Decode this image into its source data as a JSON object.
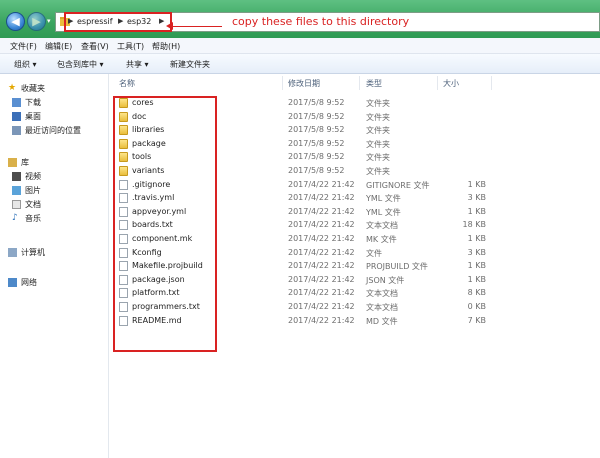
{
  "address": {
    "crumbs": [
      "espressif",
      "esp32"
    ],
    "annotation": "copy these files to this directory"
  },
  "menubar": [
    "文件(F)",
    "编辑(E)",
    "查看(V)",
    "工具(T)",
    "帮助(H)"
  ],
  "toolbar": [
    "组织 ▾",
    "包含到库中 ▾",
    "共享 ▾",
    "新建文件夹"
  ],
  "nav": {
    "favorites": "收藏夹",
    "downloads": "下载",
    "desktop": "桌面",
    "recent": "最近访问的位置",
    "libraries": "库",
    "videos": "视频",
    "pictures": "图片",
    "documents": "文档",
    "music": "音乐",
    "computer": "计算机",
    "network": "网络"
  },
  "columns": {
    "name": "名称",
    "date": "修改日期",
    "type": "类型",
    "size": "大小"
  },
  "files": [
    {
      "name": "cores",
      "date": "2017/5/8 9:52",
      "type": "文件夹",
      "size": "",
      "kind": "folder"
    },
    {
      "name": "doc",
      "date": "2017/5/8 9:52",
      "type": "文件夹",
      "size": "",
      "kind": "folder"
    },
    {
      "name": "libraries",
      "date": "2017/5/8 9:52",
      "type": "文件夹",
      "size": "",
      "kind": "folder"
    },
    {
      "name": "package",
      "date": "2017/5/8 9:52",
      "type": "文件夹",
      "size": "",
      "kind": "folder"
    },
    {
      "name": "tools",
      "date": "2017/5/8 9:52",
      "type": "文件夹",
      "size": "",
      "kind": "folder"
    },
    {
      "name": "variants",
      "date": "2017/5/8 9:52",
      "type": "文件夹",
      "size": "",
      "kind": "folder"
    },
    {
      "name": ".gitignore",
      "date": "2017/4/22 21:42",
      "type": "GITIGNORE 文件",
      "size": "1 KB",
      "kind": "file"
    },
    {
      "name": ".travis.yml",
      "date": "2017/4/22 21:42",
      "type": "YML 文件",
      "size": "3 KB",
      "kind": "file"
    },
    {
      "name": "appveyor.yml",
      "date": "2017/4/22 21:42",
      "type": "YML 文件",
      "size": "1 KB",
      "kind": "file"
    },
    {
      "name": "boards.txt",
      "date": "2017/4/22 21:42",
      "type": "文本文档",
      "size": "18 KB",
      "kind": "file"
    },
    {
      "name": "component.mk",
      "date": "2017/4/22 21:42",
      "type": "MK 文件",
      "size": "1 KB",
      "kind": "file"
    },
    {
      "name": "Kconfig",
      "date": "2017/4/22 21:42",
      "type": "文件",
      "size": "3 KB",
      "kind": "file"
    },
    {
      "name": "Makefile.projbuild",
      "date": "2017/4/22 21:42",
      "type": "PROJBUILD 文件",
      "size": "1 KB",
      "kind": "file"
    },
    {
      "name": "package.json",
      "date": "2017/4/22 21:42",
      "type": "JSON 文件",
      "size": "1 KB",
      "kind": "file"
    },
    {
      "name": "platform.txt",
      "date": "2017/4/22 21:42",
      "type": "文本文档",
      "size": "8 KB",
      "kind": "file"
    },
    {
      "name": "programmers.txt",
      "date": "2017/4/22 21:42",
      "type": "文本文档",
      "size": "0 KB",
      "kind": "file"
    },
    {
      "name": "README.md",
      "date": "2017/4/22 21:42",
      "type": "MD 文件",
      "size": "7 KB",
      "kind": "file"
    }
  ],
  "colors": {
    "annotation": "#d92222",
    "chrome": "#3aa45f"
  }
}
